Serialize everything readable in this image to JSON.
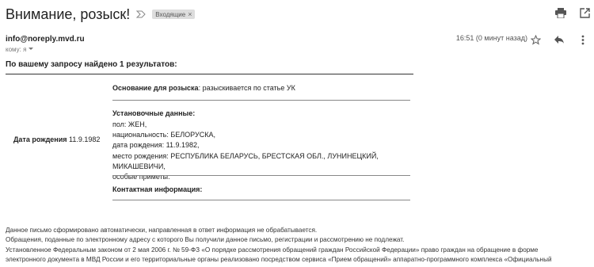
{
  "email": {
    "subject": "Внимание, розыск!",
    "label": "Входящие",
    "label_close": "×",
    "sender": "info@noreply.mvd.ru",
    "to_line": "кому: я",
    "time": "16:51 (0 минут назад)"
  },
  "icons": {
    "importance": "importance-marker-icon",
    "print": "print-icon",
    "open_new": "open-in-new-window-icon",
    "star": "star-icon",
    "reply": "reply-icon",
    "more": "more-vert-icon",
    "dropdown": "chevron-down-icon"
  },
  "body": {
    "result_line": "По вашему запросу найдено 1 результатов:",
    "dob_label": "Дата рождения",
    "dob_value": "11.9.1982",
    "basis_label": "Основание для розыска",
    "basis_value": ": разыскивается по статье УК",
    "established_title": "Установочные данные:",
    "established_lines": [
      "пол: ЖЕН,",
      "национальность: БЕЛОРУСКА,",
      "дата рождения: 11.9.1982,",
      "место рождения: РЕСПУБЛИКА БЕЛАРУСЬ, БРЕСТСКАЯ ОБЛ., ЛУНИНЕЦКИЙ, МИКАШЕВИЧИ,",
      "особые приметы:"
    ],
    "contact_title": "Контактная информация:"
  },
  "footer": {
    "lines": [
      "Данное письмо сформировано автоматически, направленная в ответ информация не обрабатывается.",
      "Обращения, поданные по электронному адресу с которого Вы получили данное письмо, регистрации и рассмотрению не подлежат.",
      "Установленное Федеральным законом от 2 мая 2006 г. № 59-ФЗ «О порядке рассмотрения обращений граждан Российской Федерации» право граждан на обращение в форме",
      "электронного документа в МВД России и его территориальные органы реализовано посредством сервиса «Прием обращений» аппаратно-программного комплекса «Официальный"
    ]
  },
  "colors": {
    "text": "#222222",
    "muted": "#777777",
    "label_bg": "#dddddd"
  }
}
